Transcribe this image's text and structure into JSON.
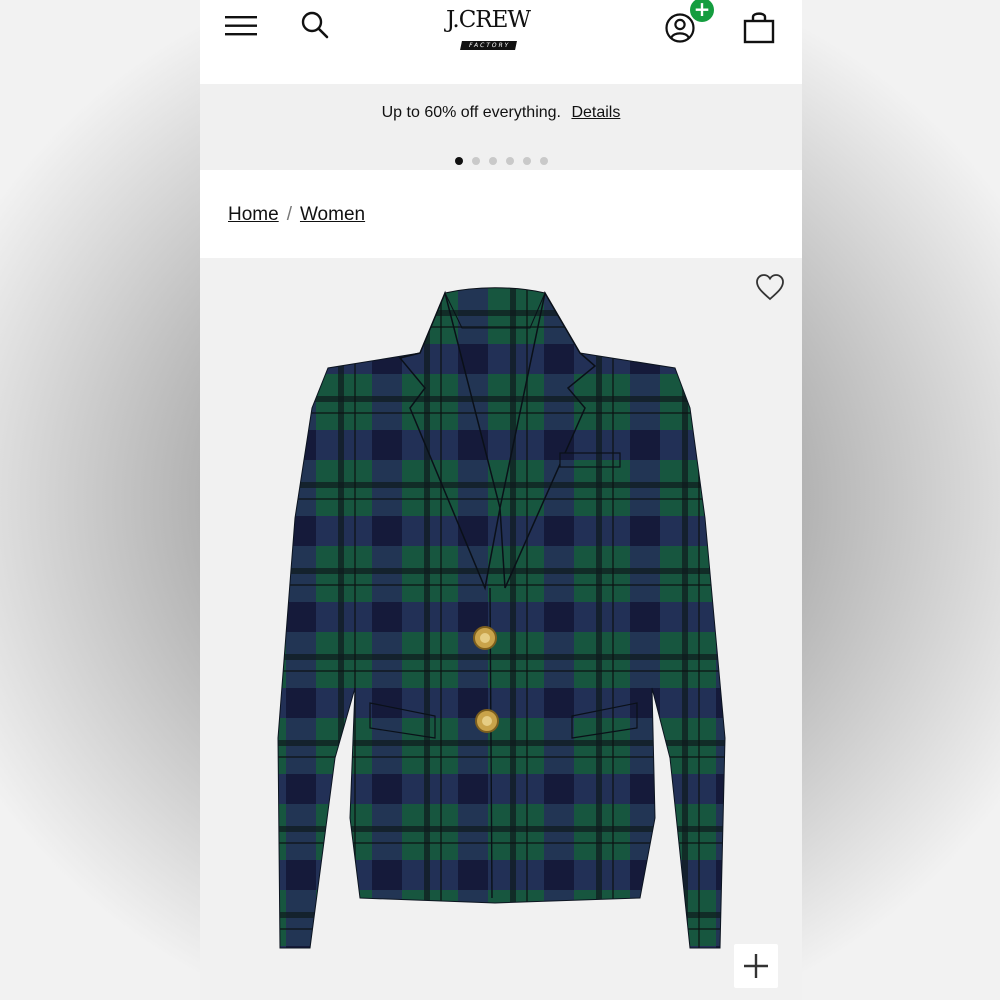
{
  "header": {
    "logo_main": "J.CREW",
    "logo_sub": "FACTORY",
    "account_badge": "+",
    "icons": [
      "menu-icon",
      "search-icon",
      "account-icon",
      "bag-icon"
    ]
  },
  "promo": {
    "text": "Up to 60% off everything.",
    "link": "Details",
    "slides": 6,
    "active_slide": 1
  },
  "breadcrumb": {
    "items": [
      "Home",
      "Women"
    ],
    "separator": "/"
  },
  "product": {
    "image": "green and navy plaid blazer with gold buttons",
    "icons": [
      "heart-icon",
      "plus-icon"
    ],
    "colors": {
      "green": "#17563f",
      "navy": "#25295a",
      "lining": "#2c3660",
      "button": "#c9a34a"
    }
  }
}
